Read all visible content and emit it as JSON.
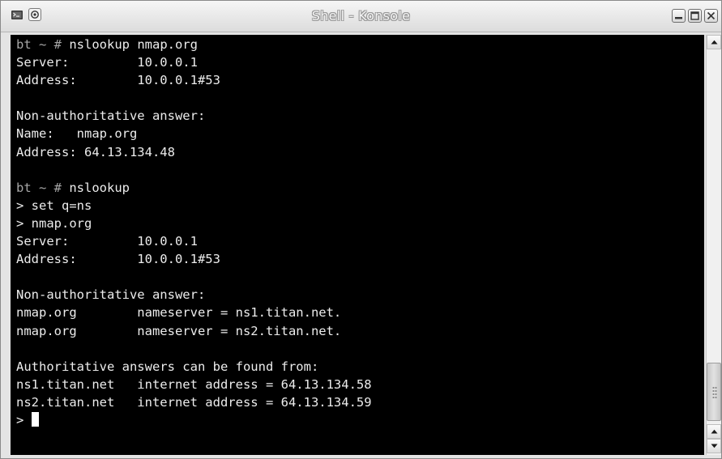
{
  "window": {
    "title": "Shell - Konsole"
  },
  "terminal": {
    "lines": [
      {
        "host": "bt ~ #",
        "text": " nslookup nmap.org"
      },
      {
        "text": "Server:         10.0.0.1"
      },
      {
        "text": "Address:        10.0.0.1#53"
      },
      {
        "text": ""
      },
      {
        "text": "Non-authoritative answer:"
      },
      {
        "text": "Name:   nmap.org"
      },
      {
        "text": "Address: 64.13.134.48"
      },
      {
        "text": ""
      },
      {
        "host": "bt ~ #",
        "text": " nslookup"
      },
      {
        "text": "> set q=ns"
      },
      {
        "text": "> nmap.org"
      },
      {
        "text": "Server:         10.0.0.1"
      },
      {
        "text": "Address:        10.0.0.1#53"
      },
      {
        "text": ""
      },
      {
        "text": "Non-authoritative answer:"
      },
      {
        "text": "nmap.org        nameserver = ns1.titan.net."
      },
      {
        "text": "nmap.org        nameserver = ns2.titan.net."
      },
      {
        "text": ""
      },
      {
        "text": "Authoritative answers can be found from:"
      },
      {
        "text": "ns1.titan.net   internet address = 64.13.134.58"
      },
      {
        "text": "ns2.titan.net   internet address = 64.13.134.59"
      }
    ],
    "input_prompt": "> "
  },
  "icons": {
    "menu": "konsole-menu-icon",
    "sticky": "sticky-icon",
    "minimize": "minimize-icon",
    "maximize": "maximize-icon",
    "close": "close-icon"
  },
  "colors": {
    "terminal_background": "#000000",
    "terminal_text": "#ececec",
    "prompt_host": "#a6a6a6"
  }
}
